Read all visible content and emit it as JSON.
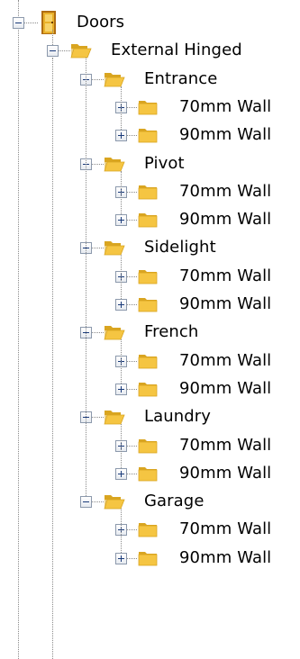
{
  "tree": {
    "root": {
      "label": "Doors",
      "icon": "door-icon",
      "expanded": true
    },
    "external": {
      "label": "External Hinged",
      "icon": "open-folder-icon",
      "expanded": true
    },
    "groups": [
      {
        "label": "Entrance",
        "children": [
          "70mm Wall",
          "90mm Wall"
        ]
      },
      {
        "label": "Pivot",
        "children": [
          "70mm Wall",
          "90mm Wall"
        ]
      },
      {
        "label": "Sidelight",
        "children": [
          "70mm Wall",
          "90mm Wall"
        ]
      },
      {
        "label": "French",
        "children": [
          "70mm Wall",
          "90mm Wall"
        ]
      },
      {
        "label": "Laundry",
        "children": [
          "70mm Wall",
          "90mm Wall"
        ]
      },
      {
        "label": "Garage",
        "children": [
          "70mm Wall",
          "90mm Wall"
        ]
      }
    ]
  },
  "colors": {
    "folder": "#f5c542",
    "folder_dark": "#d9a521",
    "door": "#e9b12a",
    "line": "#8a8a8a"
  }
}
